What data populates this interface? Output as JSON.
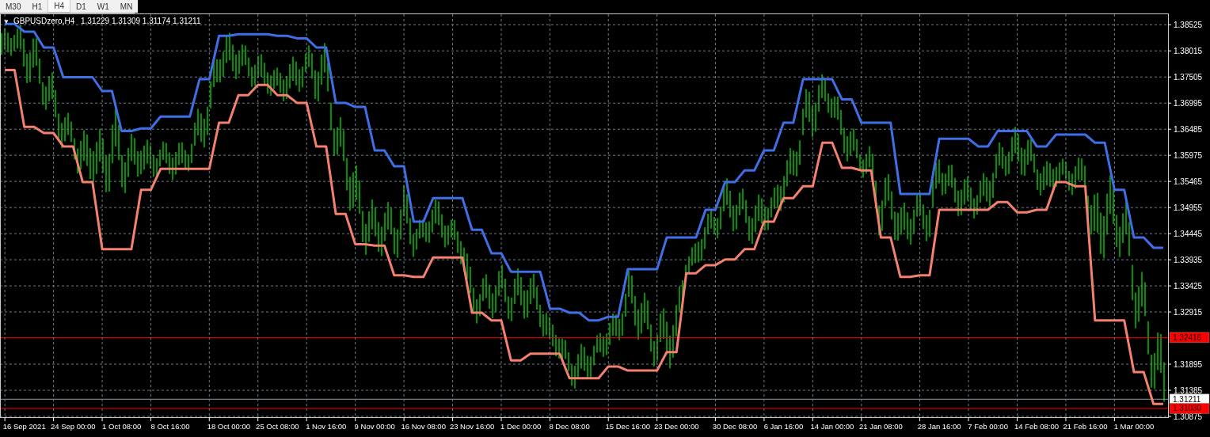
{
  "timeframes": [
    {
      "label": "M30",
      "selected": false
    },
    {
      "label": "H1",
      "selected": false
    },
    {
      "label": "H4",
      "selected": true
    },
    {
      "label": "D1",
      "selected": false
    },
    {
      "label": "W1",
      "selected": false
    },
    {
      "label": "MN",
      "selected": false
    }
  ],
  "chart": {
    "collapse_glyph": "▼",
    "symbol": "GBPUSDzero,H4",
    "ohlc": "1.31229 1.31309 1.31174 1.31211",
    "price_tags": [
      {
        "kind": "alert",
        "label": "1.32416",
        "color": "#ff0000"
      },
      {
        "kind": "bid",
        "label": "1.31211",
        "color": "#ffffff"
      },
      {
        "kind": "alert",
        "label": "1.31030",
        "color": "#ff0000"
      }
    ],
    "chart_data": {
      "type": "line",
      "grid": true,
      "ylim": [
        1.30875,
        1.3873
      ],
      "categories": [
        null,
        null,
        "16 Sep 2021",
        null,
        null,
        null,
        null,
        "24 Sep 00:00",
        null,
        null,
        null,
        null,
        "1 Oct 08:00",
        null,
        null,
        null,
        null,
        "8 Oct 16:00",
        null,
        null,
        null,
        null,
        null,
        "18 Oct 00:00",
        null,
        null,
        null,
        null,
        "25 Oct 08:00",
        null,
        null,
        null,
        null,
        "1 Nov 16:00",
        null,
        null,
        null,
        null,
        "9 Nov 00:00",
        null,
        null,
        null,
        null,
        "16 Nov 08:00",
        null,
        null,
        null,
        null,
        "23 Nov 16:00",
        null,
        null,
        null,
        null,
        "1 Dec 00:00",
        null,
        null,
        null,
        null,
        "8 Dec 08:00",
        null,
        null,
        null,
        null,
        null,
        "15 Dec 16:00",
        null,
        null,
        null,
        null,
        "23 Dec 00:00",
        null,
        null,
        null,
        null,
        null,
        "30 Dec 08:00",
        null,
        null,
        null,
        null,
        "6 Jan 16:00",
        null,
        null,
        null,
        null,
        "14 Jan 00:00",
        null,
        null,
        null,
        null,
        "21 Jan 08:00",
        null,
        null,
        null,
        null,
        null,
        "28 Jan 16:00",
        null,
        null,
        null,
        null,
        "7 Feb 00:00",
        null,
        null,
        null,
        null,
        "14 Feb 08:00",
        null,
        null,
        null,
        null,
        "21 Feb 16:00",
        null,
        null,
        null,
        null,
        "1 Mar 00:00",
        null,
        null,
        null
      ],
      "series": [
        {
          "color": "#3f6fe6",
          "values": [
            1.3854,
            1.3854,
            1.3839,
            1.3839,
            1.3808,
            1.3808,
            1.375,
            1.375,
            1.375,
            1.375,
            1.3723,
            1.3723,
            1.3645,
            1.3645,
            1.365,
            1.365,
            1.3673,
            1.3673,
            1.3673,
            1.3673,
            1.3746,
            1.3746,
            1.3831,
            1.3831,
            1.3834,
            1.3834,
            1.3834,
            1.3834,
            1.3831,
            1.3831,
            1.3826,
            1.3826,
            1.3808,
            1.3808,
            1.37,
            1.37,
            1.3692,
            1.3692,
            1.3607,
            1.3607,
            1.3576,
            1.3576,
            1.3468,
            1.3468,
            1.3514,
            1.3514,
            1.3514,
            1.3514,
            1.3452,
            1.3452,
            1.3406,
            1.3406,
            1.337,
            1.337,
            1.337,
            1.337,
            1.3298,
            1.3298,
            1.329,
            1.329,
            1.3275,
            1.3275,
            1.3282,
            1.3282,
            1.3375,
            1.3375,
            1.3375,
            1.3375,
            1.3437,
            1.3437,
            1.3437,
            1.3437,
            1.3491,
            1.3491,
            1.3545,
            1.3545,
            1.3568,
            1.3568,
            1.3607,
            1.3607,
            1.3661,
            1.3661,
            1.3746,
            1.3746,
            1.3746,
            1.3746,
            1.3707,
            1.3707,
            1.3661,
            1.3661,
            1.3661,
            1.3661,
            1.3522,
            1.3522,
            1.3522,
            1.3522,
            1.363,
            1.363,
            1.363,
            1.363,
            1.3615,
            1.3615,
            1.3645,
            1.3645,
            1.3645,
            1.3645,
            1.3615,
            1.3615,
            1.3638,
            1.3638,
            1.3638,
            1.3638,
            1.3622,
            1.3622,
            1.353,
            1.353,
            1.3437,
            1.3437,
            1.3417,
            1.3417
          ]
        },
        {
          "color": "#f4806e",
          "values": [
            1.3764,
            1.3764,
            1.3653,
            1.3653,
            1.3641,
            1.3641,
            1.3615,
            1.3615,
            1.3545,
            1.3545,
            1.3414,
            1.3414,
            1.3414,
            1.3414,
            1.353,
            1.353,
            1.3571,
            1.3571,
            1.3571,
            1.3571,
            1.3571,
            1.3571,
            1.3661,
            1.3661,
            1.3715,
            1.3715,
            1.3735,
            1.3735,
            1.3715,
            1.3715,
            1.37,
            1.37,
            1.3615,
            1.3615,
            1.3483,
            1.3483,
            1.3424,
            1.3424,
            1.3421,
            1.3421,
            1.3363,
            1.3363,
            1.336,
            1.336,
            1.3398,
            1.3398,
            1.3398,
            1.3398,
            1.329,
            1.329,
            1.3275,
            1.3275,
            1.3197,
            1.3197,
            1.321,
            1.321,
            1.321,
            1.321,
            1.3162,
            1.3162,
            1.3162,
            1.3162,
            1.3185,
            1.3185,
            1.3177,
            1.3177,
            1.3177,
            1.3177,
            1.3213,
            1.3213,
            1.3367,
            1.3367,
            1.3383,
            1.3383,
            1.3394,
            1.3394,
            1.3414,
            1.3414,
            1.3468,
            1.3468,
            1.3514,
            1.3514,
            1.3537,
            1.3537,
            1.3622,
            1.3622,
            1.3573,
            1.3573,
            1.3568,
            1.3568,
            1.3437,
            1.3437,
            1.336,
            1.336,
            1.3363,
            1.3363,
            1.3491,
            1.3491,
            1.3491,
            1.3491,
            1.3491,
            1.3491,
            1.3506,
            1.3506,
            1.3486,
            1.3486,
            1.3491,
            1.3491,
            1.3545,
            1.3545,
            1.3537,
            1.3537,
            1.3275,
            1.3275,
            1.3275,
            1.3275,
            1.3174,
            1.3174,
            1.3112,
            1.3112
          ]
        }
      ],
      "yticks": [
        {
          "value": 1.38525,
          "label": "1.38525"
        },
        {
          "value": 1.38015,
          "label": "1.38015"
        },
        {
          "value": 1.37505,
          "label": "1.37505"
        },
        {
          "value": 1.36995,
          "label": "1.36995"
        },
        {
          "value": 1.36485,
          "label": "1.36485"
        },
        {
          "value": 1.35975,
          "label": "1.35975"
        },
        {
          "value": 1.35465,
          "label": "1.35465"
        },
        {
          "value": 1.34955,
          "label": "1.34955"
        },
        {
          "value": 1.34445,
          "label": "1.34445"
        },
        {
          "value": 1.33935,
          "label": "1.33935"
        },
        {
          "value": 1.33425,
          "label": "1.33425"
        },
        {
          "value": 1.32915,
          "label": "1.32915"
        },
        {
          "value": 1.31895,
          "label": "1.31895"
        },
        {
          "value": 1.31385,
          "label": "1.31385"
        },
        {
          "value": 1.30875,
          "label": "1.30875"
        }
      ]
    }
  }
}
